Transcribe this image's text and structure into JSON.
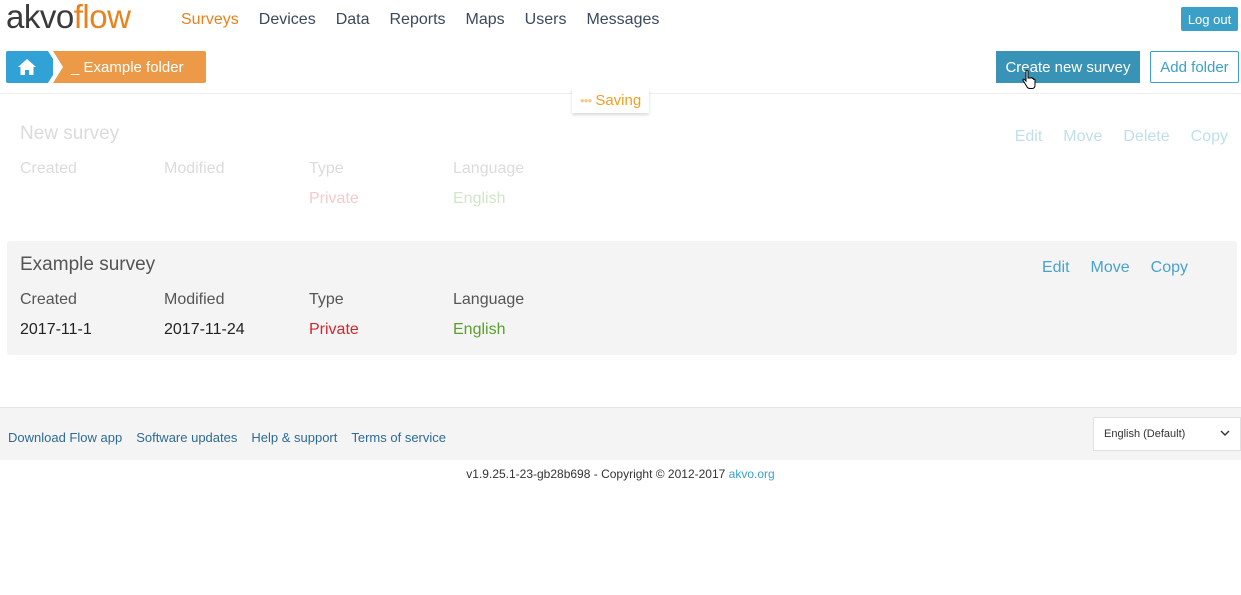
{
  "header": {
    "logo_part1": "akvo",
    "logo_part2": "flow",
    "nav": [
      "Surveys",
      "Devices",
      "Data",
      "Reports",
      "Maps",
      "Users",
      "Messages"
    ],
    "logout_label": "Log out"
  },
  "breadcrumb": {
    "folder_label": "_ Example folder"
  },
  "toolbar": {
    "create_label": "Create new survey",
    "add_folder_label": "Add folder"
  },
  "saving_label": "Saving",
  "columns": [
    "Created",
    "Modified",
    "Type",
    "Language"
  ],
  "surveys": [
    {
      "title": "New survey",
      "actions": [
        "Edit",
        "Move",
        "Delete",
        "Copy"
      ],
      "created": "",
      "modified": "",
      "type": "Private",
      "language": "English"
    },
    {
      "title": "Example survey",
      "actions": [
        "Edit",
        "Move",
        "Copy"
      ],
      "created": "2017-11-1",
      "modified": "2017-11-24",
      "type": "Private",
      "language": "English"
    }
  ],
  "footer": {
    "links": [
      "Download Flow app",
      "Software updates",
      "Help & support",
      "Terms of service"
    ],
    "language_select": "English (Default)",
    "copyright": "v1.9.25.1-23-gb28b698 - Copyright © 2012-2017",
    "copyright_link": "akvo.org"
  },
  "colors": {
    "brand_orange": "#e8821e",
    "accent_blue": "#3aa0c8",
    "private_red": "#d0282f",
    "english_green": "#5aa02c"
  }
}
